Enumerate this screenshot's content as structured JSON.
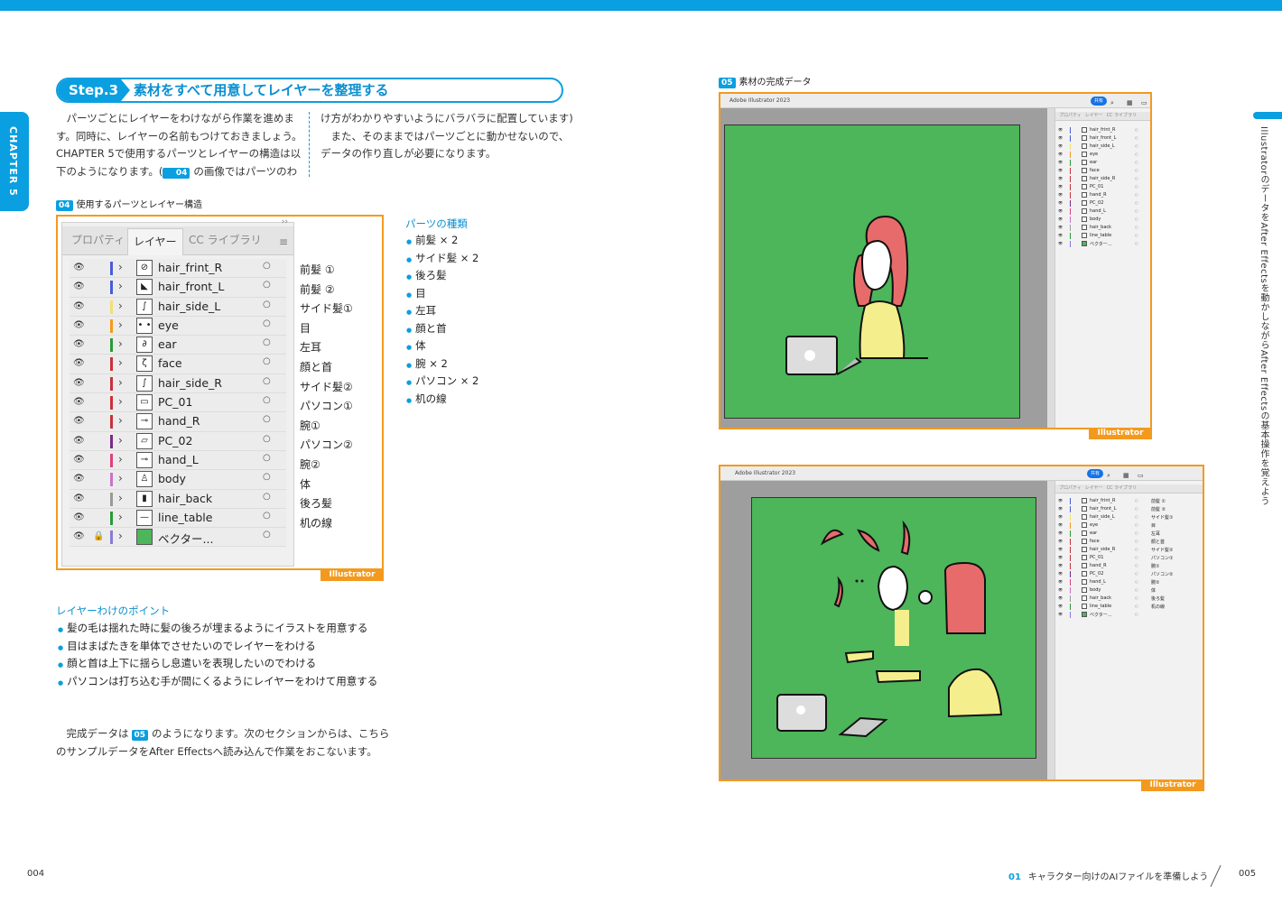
{
  "chapter_tab": "CHAPTER 5",
  "vertical_title": "IllustratorのデータをAfter Effectsを動かしながらAfter Effectsの基本操作を覚えよう",
  "step": {
    "badge": "Step.3",
    "title": "素材をすべて用意してレイヤーを整理する"
  },
  "intro": {
    "col1": "パーツごとにレイヤーをわけながら作業を進めます。同時に、レイヤーの名前もつけておきましょう。CHAPTER 5で使用するパーツとレイヤーの構造は以下のようになります。(",
    "col1_ref": "04",
    "col1_tail": "の画像ではパーツのわ",
    "col2_line1": "け方がわかりやすいようにバラバラに配置しています)",
    "col2_line2": "また、そのままではパーツごとに動かせないので、データの作り直しが必要になります。"
  },
  "fig04": {
    "num": "04",
    "label": "使用するパーツとレイヤー構造"
  },
  "fig05": {
    "num": "05",
    "label": "素材の完成データ"
  },
  "panel": {
    "tabs": [
      "プロパティ",
      "レイヤー",
      "CC ライブラリ"
    ],
    "menu_icon": "≡",
    "collapse_icon": "››",
    "layers": [
      {
        "name": "hair_frint_R",
        "color": "#4a5bd6",
        "thumb": "⊘"
      },
      {
        "name": "hair_front_L",
        "color": "#4a5bd6",
        "thumb": "◣"
      },
      {
        "name": "hair_side_L",
        "color": "#f2e070",
        "thumb": "∫"
      },
      {
        "name": "eye",
        "color": "#f39a1e",
        "thumb": "• •"
      },
      {
        "name": "ear",
        "color": "#2a9a3a",
        "thumb": "∂"
      },
      {
        "name": "face",
        "color": "#c8323a",
        "thumb": "ζ"
      },
      {
        "name": "hair_side_R",
        "color": "#c8323a",
        "thumb": "∫"
      },
      {
        "name": "PC_01",
        "color": "#c8323a",
        "thumb": "▭"
      },
      {
        "name": "hand_R",
        "color": "#c8323a",
        "thumb": "⊸"
      },
      {
        "name": "PC_02",
        "color": "#7a2a8a",
        "thumb": "▱"
      },
      {
        "name": "hand_L",
        "color": "#e0407a",
        "thumb": "⊸"
      },
      {
        "name": "body",
        "color": "#c873c8",
        "thumb": "♙"
      },
      {
        "name": "hair_back",
        "color": "#999999",
        "thumb": "▮"
      },
      {
        "name": "line_table",
        "color": "#2a9a3a",
        "thumb": "—"
      },
      {
        "name": "ベクター...",
        "color": "#8a7ad6",
        "thumb": "■",
        "locked": true
      }
    ],
    "eye_icon": "👁",
    "lock_icon": "🔒",
    "chevron": "›",
    "target": "○"
  },
  "parts_labels": [
    "前髪 ①",
    "前髪 ②",
    "サイド髪①",
    "目",
    "左耳",
    "顔と首",
    "サイド髪②",
    "パソコン①",
    "腕①",
    "パソコン②",
    "腕②",
    "体",
    "後ろ髪",
    "机の線"
  ],
  "illustrator_tag": "Illustrator",
  "kinds": {
    "head": "パーツの種類",
    "items": [
      "前髪 × 2",
      "サイド髪 × 2",
      "後ろ髪",
      "目",
      "左耳",
      "顔と首",
      "体",
      "腕 × 2",
      "パソコン × 2",
      "机の線"
    ]
  },
  "points": {
    "head": "レイヤーわけのポイント",
    "items": [
      "髪の毛は揺れた時に髪の後ろが埋まるようにイラストを用意する",
      "目はまばたきを単体でさせたいのでレイヤーをわける",
      "顔と首は上下に揺らし息遣いを表現したいのでわける",
      "パソコンは打ち込む手が間にくるようにレイヤーをわけて用意する"
    ]
  },
  "final": {
    "pre": "完成データは",
    "ref": "05",
    "post": "のようになります。次のセクションからは、こちらのサンプルデータをAfter Effectsへ読み込んで作業をおこないます。"
  },
  "app": {
    "title": "Adobe Illustrator 2023",
    "share": "共有",
    "tabs": [
      "プロパティ",
      "レイヤー",
      "CC ライブラリ"
    ]
  },
  "footer": {
    "left_page": "004",
    "section_num": "01",
    "section_title": "キャラクター向けのAIファイルを準備しよう",
    "right_page": "005"
  },
  "colors": {
    "accent": "#0a9fe0",
    "frame": "#f39a1e",
    "artboard": "#4db55a",
    "hair": "#e86b6b",
    "skin": "#f4ef8c"
  }
}
